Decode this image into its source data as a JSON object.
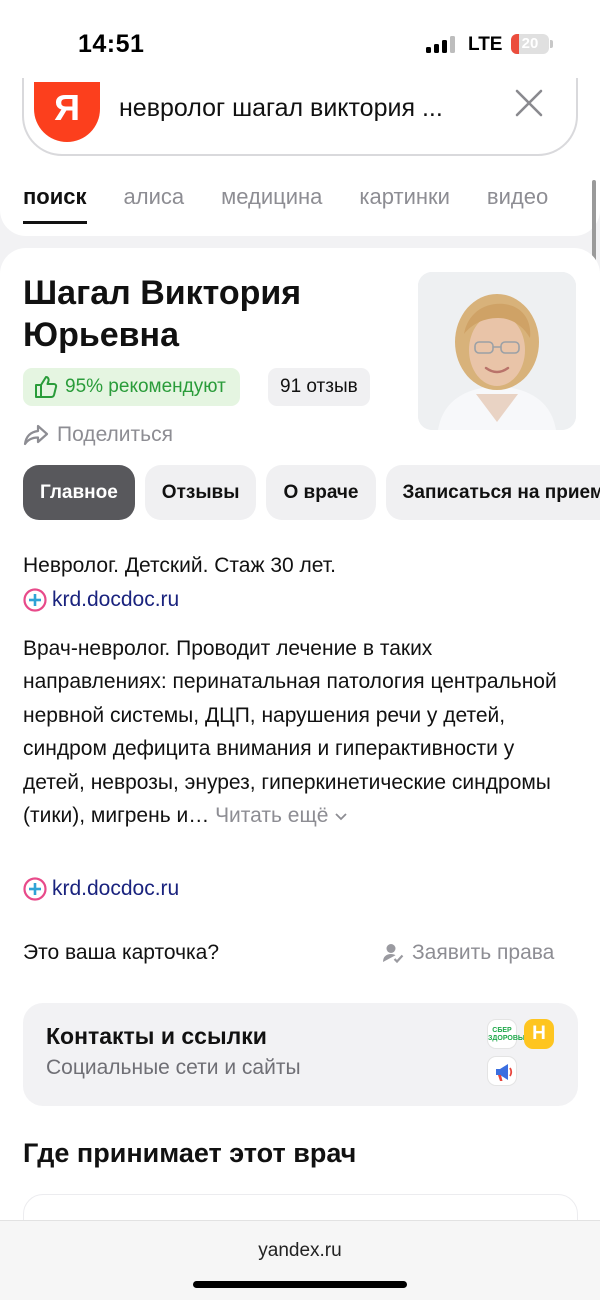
{
  "status_bar": {
    "time": "14:51",
    "network": "LTE",
    "battery_level": "20"
  },
  "search": {
    "query": "невролог шагал виктория ...",
    "logo_letter": "Я"
  },
  "tabs": [
    {
      "label": "поиск",
      "active": true
    },
    {
      "label": "алиса",
      "active": false
    },
    {
      "label": "медицина",
      "active": false
    },
    {
      "label": "картинки",
      "active": false
    },
    {
      "label": "видео",
      "active": false
    }
  ],
  "doctor": {
    "name": "Шагал Виктория Юрьевна",
    "recommend": "95% рекомендуют",
    "reviews": "91 отзыв",
    "share": "Поделиться"
  },
  "chips": [
    "Главное",
    "Отзывы",
    "О враче",
    "Записаться на прием"
  ],
  "info": {
    "short": "Невролог. Детский. Стаж 30 лет.",
    "source_link": "krd.docdoc.ru",
    "description": "Врач-невролог. Проводит лечение в таких направлениях: перинатальная патология центральной нервной системы, ДЦП, нарушения речи у детей, синдром дефицита внимания и гиперактивности у детей, неврозы, энурез, гиперкинетические синдромы (тики), мигрень и…",
    "read_more": "Читать ещё",
    "source_link_2": "krd.docdoc.ru"
  },
  "claim": {
    "question": "Это ваша карточка?",
    "action": "Заявить права"
  },
  "contacts": {
    "title": "Контакты и ссылки",
    "subtitle": "Социальные сети и сайты",
    "icons": [
      "sber-zdorovie-icon",
      "n-icon",
      "megaphone-icon"
    ],
    "sber_text": "СБЕР ЗДОРОВЬЕ",
    "n_letter": "Н"
  },
  "section_title": "Где принимает этот врач",
  "browser": {
    "url": "yandex.ru"
  },
  "colors": {
    "accent_red": "#fc3f1d",
    "green": "#2a9c3a",
    "link": "#1a237e",
    "chip_active": "#58585c"
  }
}
